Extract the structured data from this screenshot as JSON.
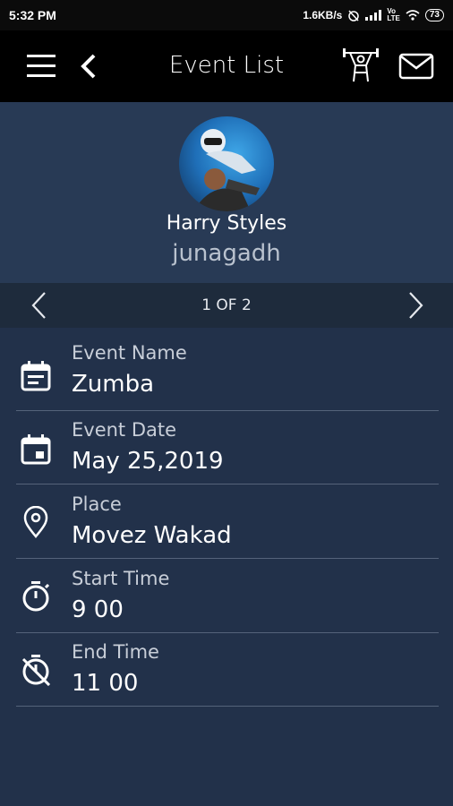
{
  "status_bar": {
    "time": "5:32 PM",
    "network_speed": "1.6KB/s",
    "battery": "73"
  },
  "app_bar": {
    "title": "Event List",
    "icons": [
      "menu-icon",
      "back-icon",
      "weightlift-icon",
      "mail-icon"
    ]
  },
  "profile": {
    "name": "Harry Styles",
    "city": "junagadh"
  },
  "pager": {
    "label": "1 OF 2"
  },
  "event": {
    "fields": [
      {
        "label": "Event Name",
        "value": "Zumba",
        "icon": "event-note-icon"
      },
      {
        "label": "Event Date",
        "value": "May 25,2019",
        "icon": "calendar-icon"
      },
      {
        "label": "Place",
        "value": "Movez Wakad",
        "icon": "location-pin-icon"
      },
      {
        "label": "Start Time",
        "value": "9 00",
        "icon": "timer-icon"
      },
      {
        "label": "End Time",
        "value": "11 00",
        "icon": "timer-off-icon"
      }
    ]
  },
  "colors": {
    "background": "#22314a",
    "app_bar": "#000000",
    "pager": "#1e2b3c",
    "divider": "#55637a"
  }
}
